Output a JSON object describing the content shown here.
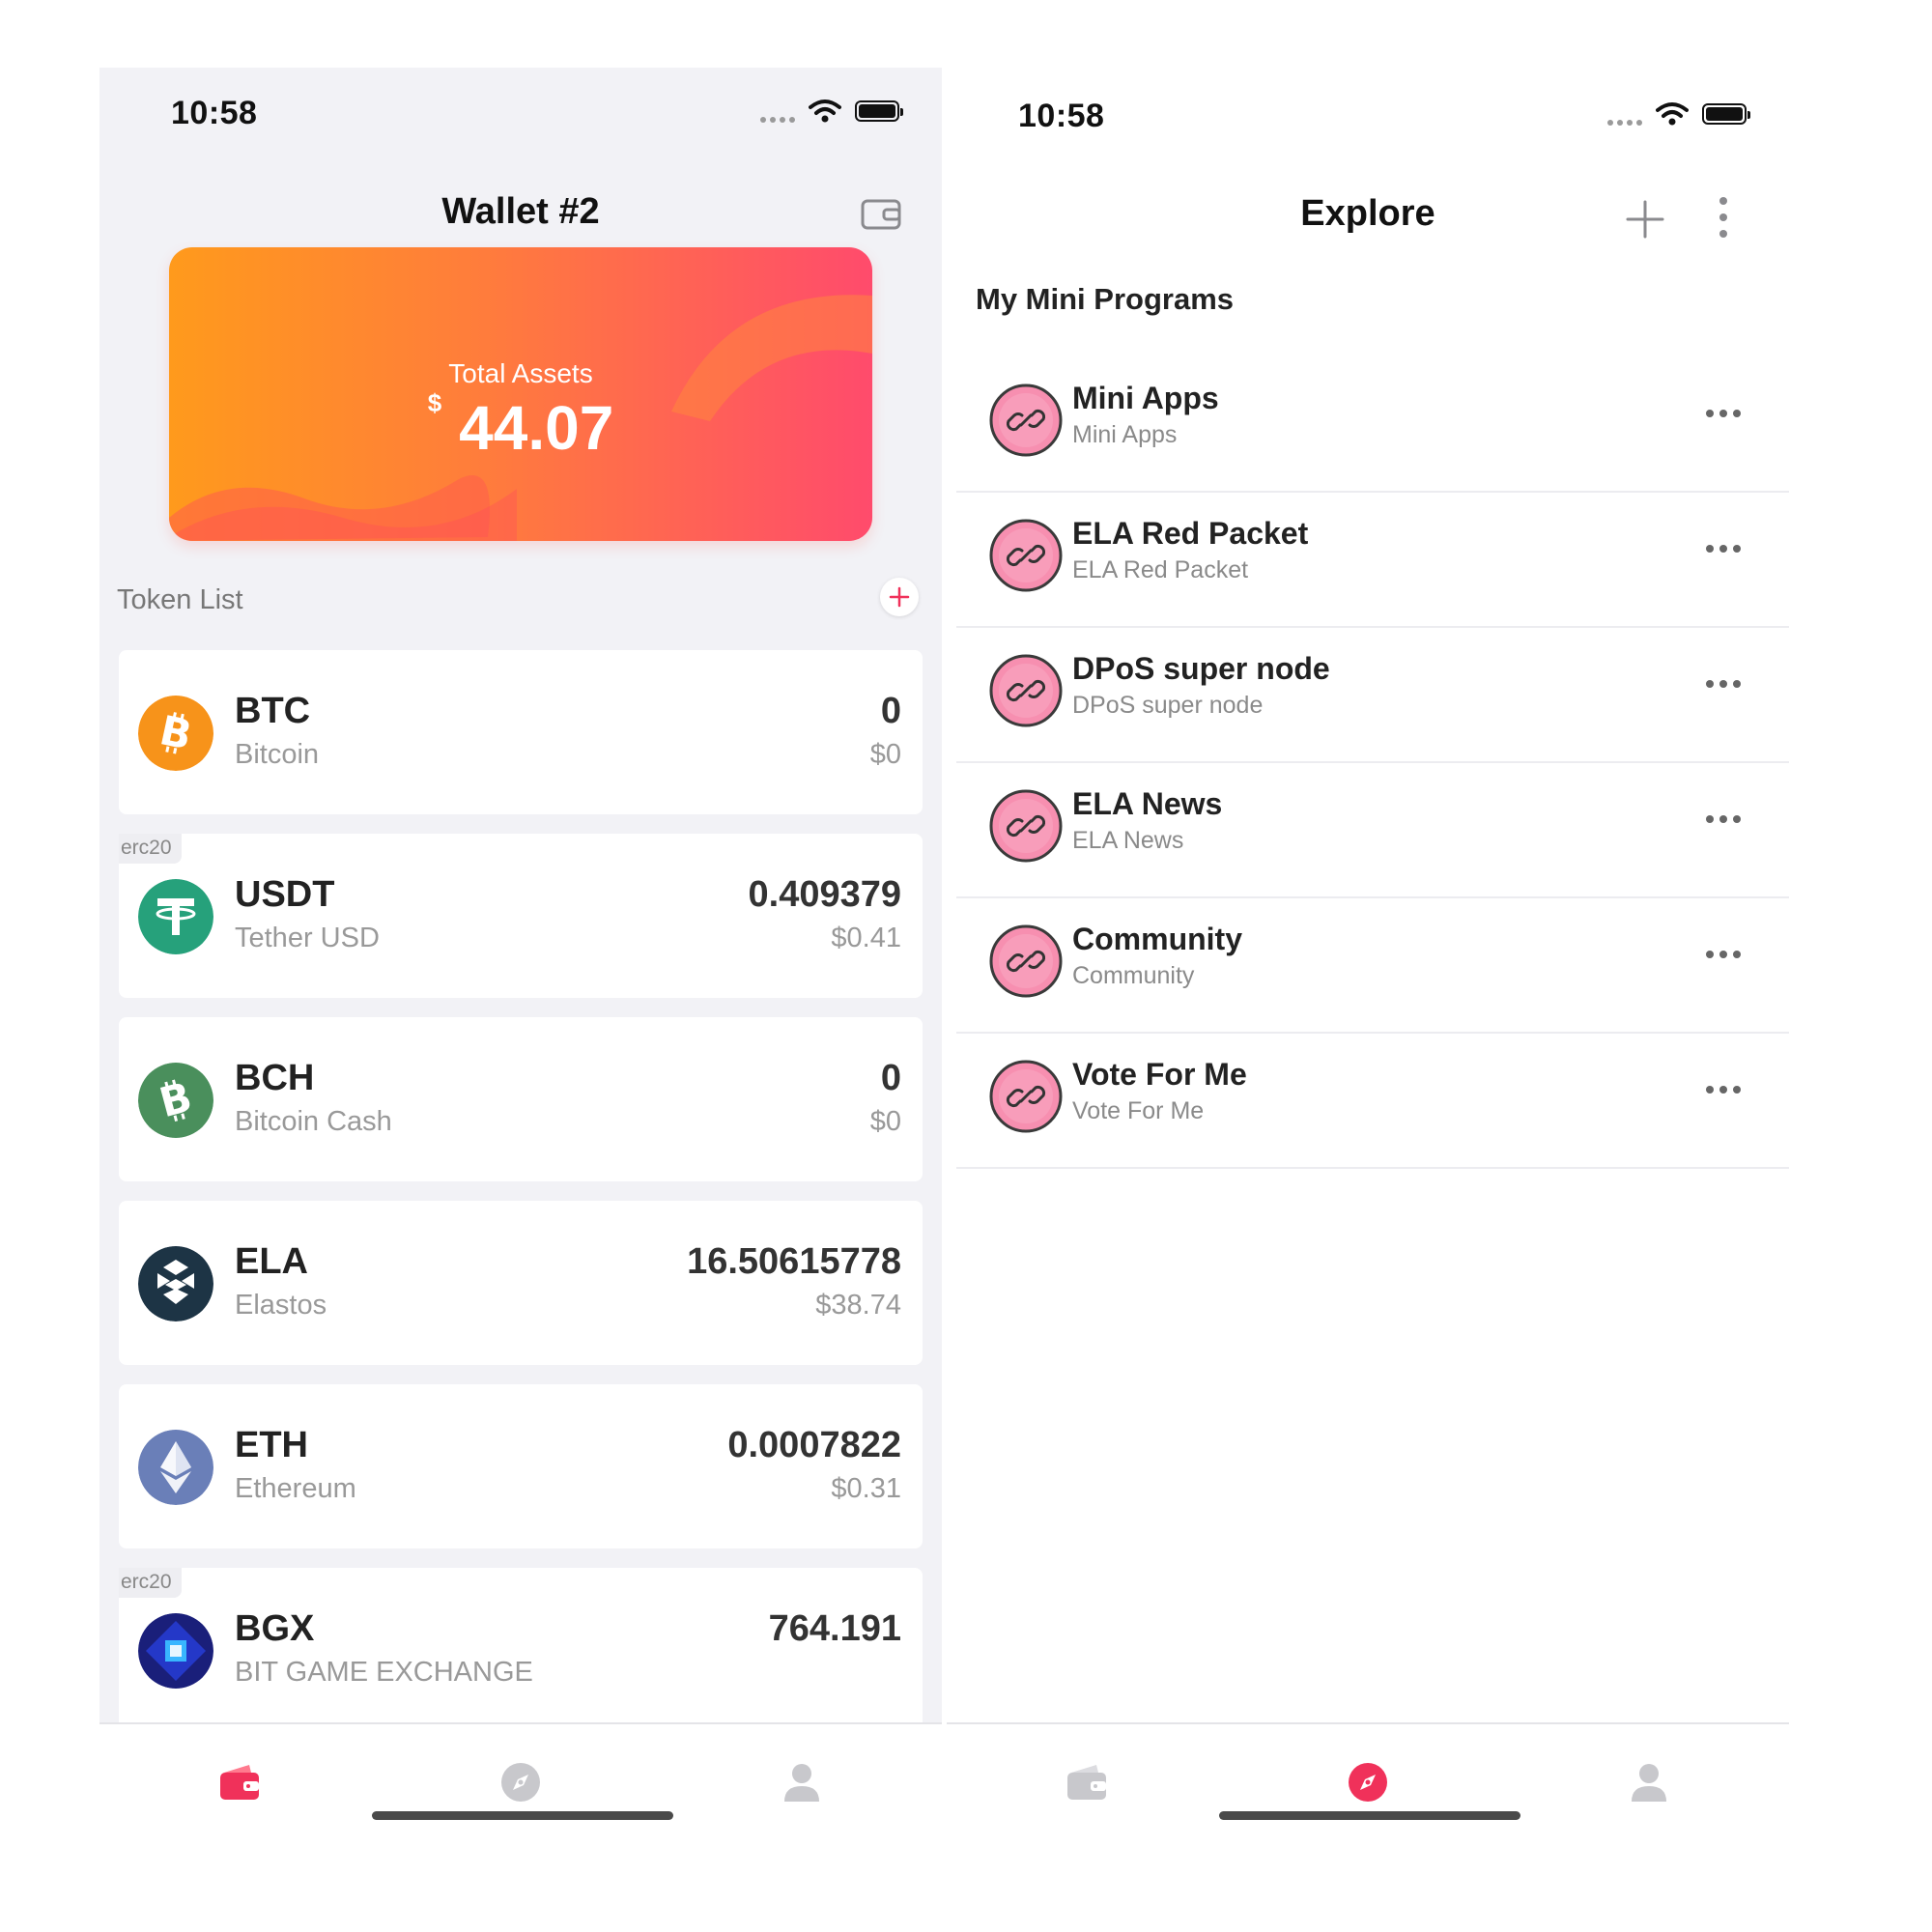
{
  "left_screen": {
    "status_time": "10:58",
    "title": "Wallet #2",
    "total_assets": {
      "label": "Total Assets",
      "currency": "$",
      "amount": "44.07"
    },
    "token_list_label": "Token List",
    "tokens": [
      {
        "symbol": "BTC",
        "name": "Bitcoin",
        "balance": "0",
        "value": "$0",
        "tag": "",
        "icon": "bitcoin-icon",
        "color": "#f7931a"
      },
      {
        "symbol": "USDT",
        "name": "Tether USD",
        "balance": "0.409379",
        "value": "$0.41",
        "tag": "erc20",
        "icon": "tether-icon",
        "color": "#26a17b"
      },
      {
        "symbol": "BCH",
        "name": "Bitcoin Cash",
        "balance": "0",
        "value": "$0",
        "tag": "",
        "icon": "bitcoin-cash-icon",
        "color": "#4a8f5c"
      },
      {
        "symbol": "ELA",
        "name": "Elastos",
        "balance": "16.50615778",
        "value": "$38.74",
        "tag": "",
        "icon": "elastos-icon",
        "color": "#1d3445"
      },
      {
        "symbol": "ETH",
        "name": "Ethereum",
        "balance": "0.0007822",
        "value": "$0.31",
        "tag": "",
        "icon": "ethereum-icon",
        "color": "#6a7fb8"
      },
      {
        "symbol": "BGX",
        "name": "BIT GAME EXCHANGE",
        "balance": "764.191",
        "value": "",
        "tag": "erc20",
        "icon": "bgx-icon",
        "color": "#1a2a9a"
      }
    ],
    "tabs": [
      {
        "name": "wallet",
        "icon": "wallet-icon",
        "active": true
      },
      {
        "name": "explore",
        "icon": "compass-icon",
        "active": false
      },
      {
        "name": "profile",
        "icon": "user-icon",
        "active": false
      }
    ]
  },
  "right_screen": {
    "status_time": "10:58",
    "title": "Explore",
    "section_title": "My Mini Programs",
    "programs": [
      {
        "title": "Mini Apps",
        "subtitle": "Mini Apps"
      },
      {
        "title": "ELA Red Packet",
        "subtitle": "ELA Red Packet"
      },
      {
        "title": "DPoS super node",
        "subtitle": "DPoS super node"
      },
      {
        "title": "ELA News",
        "subtitle": "ELA News"
      },
      {
        "title": "Community",
        "subtitle": "Community"
      },
      {
        "title": "Vote For Me",
        "subtitle": "Vote For Me"
      }
    ],
    "tabs": [
      {
        "name": "wallet",
        "icon": "wallet-icon",
        "active": false
      },
      {
        "name": "explore",
        "icon": "compass-icon",
        "active": true
      },
      {
        "name": "profile",
        "icon": "user-icon",
        "active": false
      }
    ]
  },
  "colors": {
    "accent": "#f0315a",
    "card_gradient_start": "#ff9a1c",
    "card_gradient_end": "#ff4b6c",
    "inactive_icon": "#c8c8cc"
  }
}
